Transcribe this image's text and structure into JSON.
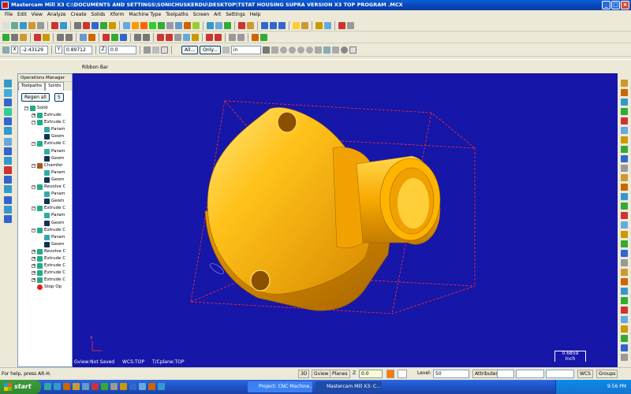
{
  "window": {
    "title": "Mastercam Mill X3   C:\\DOCUMENTS AND SETTINGS\\SONICHUSKERDU\\DESKTOP\\TSTAT HOUSING SUPRA VERSION X3 TOP PROGRAM .MCX",
    "controls": [
      "_",
      "□",
      "×"
    ]
  },
  "menu": [
    "File",
    "Edit",
    "View",
    "Analyze",
    "Create",
    "Solids",
    "Xform",
    "Machine Type",
    "Toolpaths",
    "Screen",
    "Art",
    "Settings",
    "Help"
  ],
  "coords": {
    "x_label": "X",
    "x_value": "-2.43129",
    "y_label": "Y",
    "y_value": "0.89712",
    "z_label": "Z",
    "z_value": "0.0",
    "all_button": "All...",
    "only_button": "Only...",
    "units": "in"
  },
  "ribbon_label": "Ribbon Bar",
  "operations": {
    "header": "Operations Manager",
    "tabs": [
      "Toolpaths",
      "Solids"
    ],
    "active_tab": "Solids",
    "regen_button": "Regen all",
    "second_button": "S",
    "tree": [
      {
        "label": "Solid",
        "level": 0,
        "expand": "−",
        "icon": "solid"
      },
      {
        "label": "Extrude",
        "level": 1,
        "expand": "+",
        "icon": "extrude"
      },
      {
        "label": "Extrude C",
        "level": 1,
        "expand": "−",
        "icon": "extrude"
      },
      {
        "label": "Param",
        "level": 2,
        "expand": "",
        "icon": "param"
      },
      {
        "label": "Geom",
        "level": 2,
        "expand": "",
        "icon": "geom"
      },
      {
        "label": "Extrude C",
        "level": 1,
        "expand": "−",
        "icon": "extrude"
      },
      {
        "label": "Param",
        "level": 2,
        "expand": "",
        "icon": "param"
      },
      {
        "label": "Geom",
        "level": 2,
        "expand": "",
        "icon": "geom"
      },
      {
        "label": "Chamfer",
        "level": 1,
        "expand": "−",
        "icon": "chamfer"
      },
      {
        "label": "Param",
        "level": 2,
        "expand": "",
        "icon": "param"
      },
      {
        "label": "Geom",
        "level": 2,
        "expand": "",
        "icon": "geom"
      },
      {
        "label": "Revolve C",
        "level": 1,
        "expand": "−",
        "icon": "extrude"
      },
      {
        "label": "Param",
        "level": 2,
        "expand": "",
        "icon": "param"
      },
      {
        "label": "Geom",
        "level": 2,
        "expand": "",
        "icon": "geom"
      },
      {
        "label": "Extrude C",
        "level": 1,
        "expand": "−",
        "icon": "extrude"
      },
      {
        "label": "Param",
        "level": 2,
        "expand": "",
        "icon": "param"
      },
      {
        "label": "Geom",
        "level": 2,
        "expand": "",
        "icon": "geom"
      },
      {
        "label": "Extrude C",
        "level": 1,
        "expand": "−",
        "icon": "extrude"
      },
      {
        "label": "Param",
        "level": 2,
        "expand": "",
        "icon": "param"
      },
      {
        "label": "Geom",
        "level": 2,
        "expand": "",
        "icon": "geom"
      },
      {
        "label": "Revolve C",
        "level": 1,
        "expand": "+",
        "icon": "extrude"
      },
      {
        "label": "Extrude C",
        "level": 1,
        "expand": "+",
        "icon": "extrude"
      },
      {
        "label": "Extrude C",
        "level": 1,
        "expand": "+",
        "icon": "extrude"
      },
      {
        "label": "Extrude C",
        "level": 1,
        "expand": "+",
        "icon": "extrude"
      },
      {
        "label": "Extrude C",
        "level": 1,
        "expand": "+",
        "icon": "extrude"
      },
      {
        "label": "Stop Op",
        "level": 1,
        "expand": "",
        "icon": "stop"
      }
    ]
  },
  "viewport": {
    "axis_label": "Y",
    "gview": "Gview:Not Saved",
    "wcs": "WCS:TOP",
    "tcplane": "T/Cplane:TOP",
    "scale_value": "0.6859",
    "scale_units": "Inch",
    "background_color": "#1616a8",
    "part_color": "#f5a400"
  },
  "status": {
    "help": "For help, press Alt-H.",
    "mode_3d": "3D",
    "gview_btn": "Gview",
    "planes_btn": "Planes",
    "z_label": "Z",
    "z_value": "0.0",
    "level_label": "Level:",
    "level_value": "50",
    "attributes_btn": "Attributes",
    "wcs_btn": "WCS",
    "groups_btn": "Groups"
  },
  "taskbar": {
    "start": "start",
    "tasks": [
      "Project: CNC Machine...",
      "Mastercam Mill X3: C..."
    ],
    "clock": "9:56 PM"
  }
}
